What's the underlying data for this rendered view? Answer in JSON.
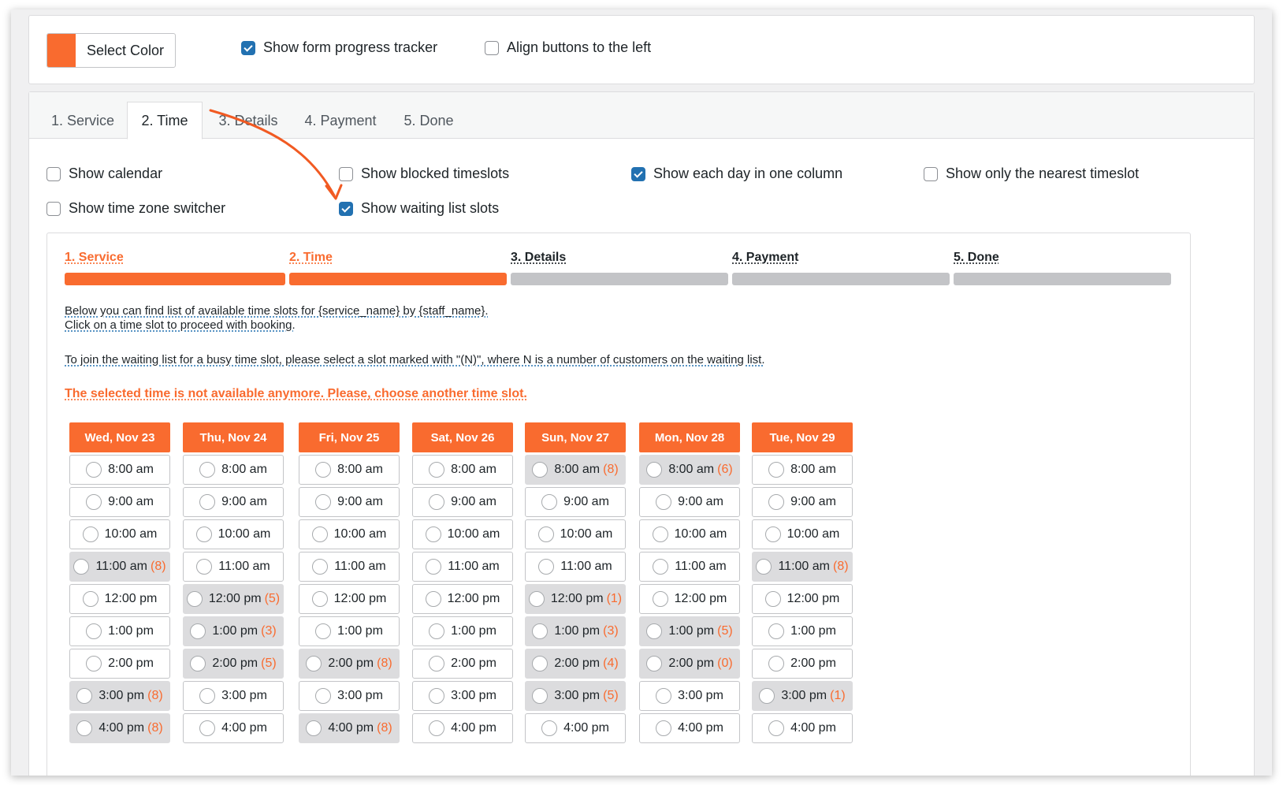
{
  "top": {
    "select_color_label": "Select Color",
    "select_color_value": "#f96b2f",
    "show_progress_tracker": {
      "label": "Show form progress tracker",
      "checked": true
    },
    "align_left": {
      "label": "Align buttons to the left",
      "checked": false
    }
  },
  "tabs": [
    {
      "label": "1. Service",
      "active": false
    },
    {
      "label": "2. Time",
      "active": true
    },
    {
      "label": "3. Details",
      "active": false
    },
    {
      "label": "4. Payment",
      "active": false
    },
    {
      "label": "5. Done",
      "active": false
    }
  ],
  "options": {
    "show_calendar": {
      "label": "Show calendar",
      "checked": false
    },
    "show_blocked": {
      "label": "Show blocked timeslots",
      "checked": false
    },
    "show_each_day": {
      "label": "Show each day in one column",
      "checked": true
    },
    "show_nearest": {
      "label": "Show only the nearest timeslot",
      "checked": false
    },
    "show_timezone": {
      "label": "Show time zone switcher",
      "checked": false
    },
    "show_waiting": {
      "label": "Show waiting list slots",
      "checked": true
    }
  },
  "steps": [
    {
      "label": "1. Service",
      "done": true
    },
    {
      "label": "2. Time",
      "done": true
    },
    {
      "label": "3. Details",
      "done": false
    },
    {
      "label": "4. Payment",
      "done": false
    },
    {
      "label": "5. Done",
      "done": false
    }
  ],
  "info": {
    "line1": "Below you can find list of available time slots for {service_name} by {staff_name}.",
    "line2": "Click on a time slot to proceed with booking.",
    "waiting": "To join the waiting list for a busy time slot, please select a slot marked with \"(N)\", where N is a number of customers on the waiting list.",
    "error": "The selected time is not available anymore. Please, choose another time slot."
  },
  "colors": {
    "accent": "#f96b2f",
    "checkbox": "#2271b1"
  },
  "days": [
    {
      "name": "Wed, Nov 23",
      "slots": [
        {
          "time": "8:00 am",
          "wl": null
        },
        {
          "time": "9:00 am",
          "wl": null
        },
        {
          "time": "10:00 am",
          "wl": null
        },
        {
          "time": "11:00 am",
          "wl": "(8)"
        },
        {
          "time": "12:00 pm",
          "wl": null
        },
        {
          "time": "1:00 pm",
          "wl": null
        },
        {
          "time": "2:00 pm",
          "wl": null
        },
        {
          "time": "3:00 pm",
          "wl": "(8)"
        },
        {
          "time": "4:00 pm",
          "wl": "(8)"
        }
      ]
    },
    {
      "name": "Thu, Nov 24",
      "slots": [
        {
          "time": "8:00 am",
          "wl": null
        },
        {
          "time": "9:00 am",
          "wl": null
        },
        {
          "time": "10:00 am",
          "wl": null
        },
        {
          "time": "11:00 am",
          "wl": null
        },
        {
          "time": "12:00 pm",
          "wl": "(5)"
        },
        {
          "time": "1:00 pm",
          "wl": "(3)"
        },
        {
          "time": "2:00 pm",
          "wl": "(5)"
        },
        {
          "time": "3:00 pm",
          "wl": null
        },
        {
          "time": "4:00 pm",
          "wl": null
        }
      ]
    },
    {
      "name": "Fri, Nov 25",
      "slots": [
        {
          "time": "8:00 am",
          "wl": null
        },
        {
          "time": "9:00 am",
          "wl": null
        },
        {
          "time": "10:00 am",
          "wl": null
        },
        {
          "time": "11:00 am",
          "wl": null
        },
        {
          "time": "12:00 pm",
          "wl": null
        },
        {
          "time": "1:00 pm",
          "wl": null
        },
        {
          "time": "2:00 pm",
          "wl": "(8)"
        },
        {
          "time": "3:00 pm",
          "wl": null
        },
        {
          "time": "4:00 pm",
          "wl": "(8)"
        }
      ]
    },
    {
      "name": "Sat, Nov 26",
      "slots": [
        {
          "time": "8:00 am",
          "wl": null
        },
        {
          "time": "9:00 am",
          "wl": null
        },
        {
          "time": "10:00 am",
          "wl": null
        },
        {
          "time": "11:00 am",
          "wl": null
        },
        {
          "time": "12:00 pm",
          "wl": null
        },
        {
          "time": "1:00 pm",
          "wl": null
        },
        {
          "time": "2:00 pm",
          "wl": null
        },
        {
          "time": "3:00 pm",
          "wl": null
        },
        {
          "time": "4:00 pm",
          "wl": null
        }
      ]
    },
    {
      "name": "Sun, Nov 27",
      "slots": [
        {
          "time": "8:00 am",
          "wl": "(8)"
        },
        {
          "time": "9:00 am",
          "wl": null
        },
        {
          "time": "10:00 am",
          "wl": null
        },
        {
          "time": "11:00 am",
          "wl": null
        },
        {
          "time": "12:00 pm",
          "wl": "(1)"
        },
        {
          "time": "1:00 pm",
          "wl": "(3)"
        },
        {
          "time": "2:00 pm",
          "wl": "(4)"
        },
        {
          "time": "3:00 pm",
          "wl": "(5)"
        },
        {
          "time": "4:00 pm",
          "wl": null
        }
      ]
    },
    {
      "name": "Mon, Nov 28",
      "slots": [
        {
          "time": "8:00 am",
          "wl": "(6)"
        },
        {
          "time": "9:00 am",
          "wl": null
        },
        {
          "time": "10:00 am",
          "wl": null
        },
        {
          "time": "11:00 am",
          "wl": null
        },
        {
          "time": "12:00 pm",
          "wl": null
        },
        {
          "time": "1:00 pm",
          "wl": "(5)"
        },
        {
          "time": "2:00 pm",
          "wl": "(0)"
        },
        {
          "time": "3:00 pm",
          "wl": null
        },
        {
          "time": "4:00 pm",
          "wl": null
        }
      ]
    },
    {
      "name": "Tue, Nov 29",
      "slots": [
        {
          "time": "8:00 am",
          "wl": null
        },
        {
          "time": "9:00 am",
          "wl": null
        },
        {
          "time": "10:00 am",
          "wl": null
        },
        {
          "time": "11:00 am",
          "wl": "(8)"
        },
        {
          "time": "12:00 pm",
          "wl": null
        },
        {
          "time": "1:00 pm",
          "wl": null
        },
        {
          "time": "2:00 pm",
          "wl": null
        },
        {
          "time": "3:00 pm",
          "wl": "(1)"
        },
        {
          "time": "4:00 pm",
          "wl": null
        }
      ]
    }
  ]
}
